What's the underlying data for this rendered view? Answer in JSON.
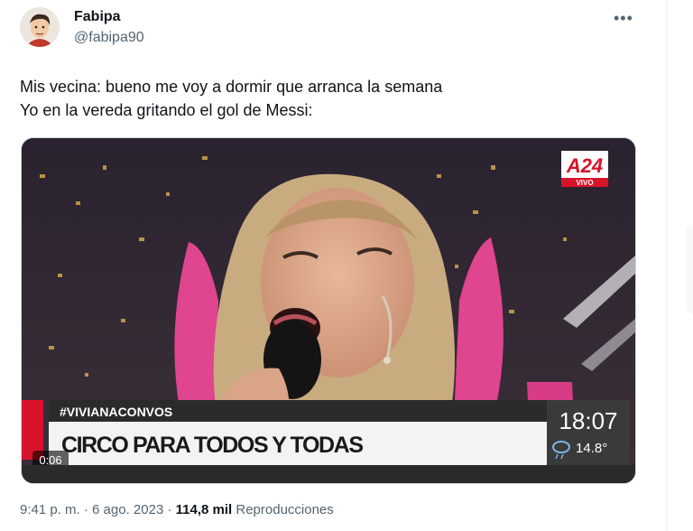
{
  "author": {
    "name": "Fabipa",
    "handle": "@fabipa90"
  },
  "tweet": {
    "line1": "Mis vecina: bueno me voy a dormir que arranca la semana",
    "line2": "Yo en la vereda gritando el gol de Messi:"
  },
  "video": {
    "channel_logo": "A24",
    "channel_tag": "VIVO",
    "hashtag": "#VIVIANACONVOS",
    "headline": "CIRCO PARA TODOS Y TODAS",
    "clock": "18:07",
    "temperature": "14.8°",
    "timestamp": "0:06",
    "weather_icon": "cloud-rain-icon"
  },
  "meta": {
    "time": "9:41 p. m.",
    "separator": "·",
    "date": "6 ago. 2023",
    "views_count": "114,8 mil",
    "views_label": "Reproducciones"
  },
  "icons": {
    "more": "more-icon"
  },
  "colors": {
    "accent_red": "#d7132a",
    "banner_white": "#f3f3f3",
    "text_gray": "#536471"
  }
}
